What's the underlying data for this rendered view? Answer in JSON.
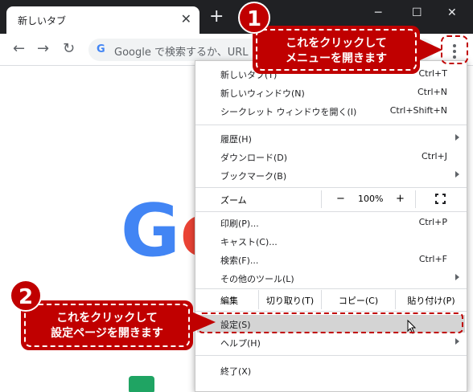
{
  "browser": {
    "tab_title": "新しいタブ",
    "tab_close": "✕",
    "new_tab": "+",
    "window_controls": {
      "minimize": "─",
      "maximize": "☐",
      "close": "✕"
    },
    "back": "←",
    "forward": "→",
    "reload": "↻",
    "omnibox_g": "G",
    "omnibox_text": "Google で検索するか、URL を"
  },
  "menu": {
    "items_top": [
      {
        "label": "新しいタブ(T)",
        "shortcut": "Ctrl+T"
      },
      {
        "label": "新しいウィンドウ(N)",
        "shortcut": "Ctrl+N"
      },
      {
        "label": "シークレット ウィンドウを開く(I)",
        "shortcut": "Ctrl+Shift+N"
      }
    ],
    "history": {
      "label": "履歴(H)"
    },
    "downloads": {
      "label": "ダウンロード(D)",
      "shortcut": "Ctrl+J"
    },
    "bookmarks": {
      "label": "ブックマーク(B)"
    },
    "zoom": {
      "label": "ズーム",
      "minus": "−",
      "value": "100%",
      "plus": "+"
    },
    "print": {
      "label": "印刷(P)...",
      "shortcut": "Ctrl+P"
    },
    "cast": {
      "label": "キャスト(C)..."
    },
    "find": {
      "label": "検索(F)...",
      "shortcut": "Ctrl+F"
    },
    "more_tools": {
      "label": "その他のツール(L)"
    },
    "edit": {
      "label": "編集",
      "cut": "切り取り(T)",
      "copy": "コピー(C)",
      "paste": "貼り付け(P)"
    },
    "settings": {
      "label": "設定(S)"
    },
    "help": {
      "label": "ヘルプ(H)"
    },
    "exit": {
      "label": "終了(X)"
    }
  },
  "annotations": {
    "step1": {
      "number": "1",
      "line1": "これをクリックして",
      "line2": "メニューを開きます"
    },
    "step2": {
      "number": "2",
      "line1": "これをクリックして",
      "line2": "設定ページを開きます"
    }
  },
  "page": {
    "logo_g": "G",
    "logo_o": "o"
  },
  "colors": {
    "annotation": "#c00000",
    "titlebar": "#202124",
    "highlight": "#d4d4d4"
  }
}
